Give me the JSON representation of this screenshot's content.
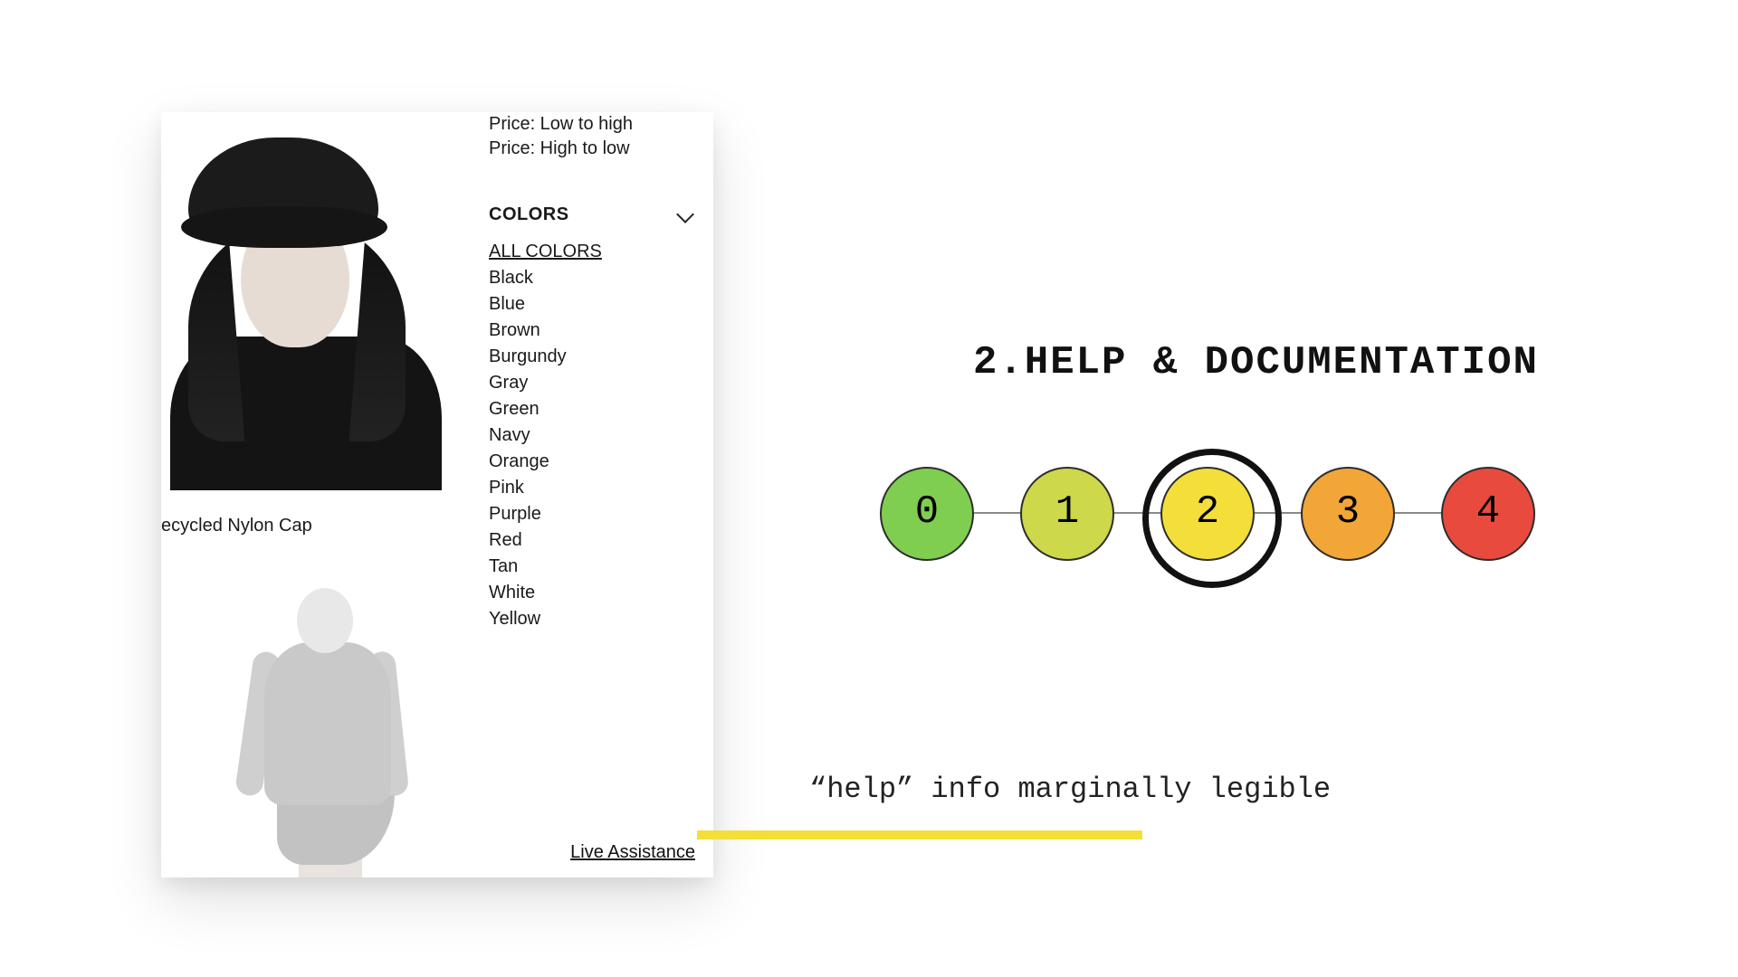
{
  "phone": {
    "product1_label": "ecycled Nylon Cap",
    "sort_options": [
      "Price: Low to high",
      "Price: High to low"
    ],
    "colors_header": "COLORS",
    "colors_all": "ALL COLORS",
    "colors": [
      "Black",
      "Blue",
      "Brown",
      "Burgundy",
      "Gray",
      "Green",
      "Navy",
      "Orange",
      "Pink",
      "Purple",
      "Red",
      "Tan",
      "White",
      "Yellow"
    ],
    "live_assistance": "Live Assistance"
  },
  "heading": "2.HELP & DOCUMENTATION",
  "scale": {
    "values": [
      "0",
      "1",
      "2",
      "3",
      "4"
    ],
    "selected": 2
  },
  "caption": "“help” info marginally legible"
}
